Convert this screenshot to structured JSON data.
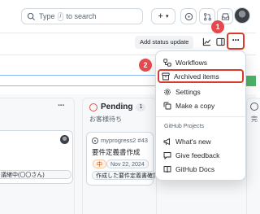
{
  "header": {
    "search_prefix": "Type",
    "search_key": "/",
    "search_suffix": "to search",
    "plus_label": "+",
    "plus_caret": "▾"
  },
  "toolbar": {
    "status_label": "Add status update",
    "more_label": "···",
    "badge1": "1",
    "badge2": "2"
  },
  "board": {
    "left_card_chip": "議継中(〇〇さん)",
    "pending": {
      "title": "Pending",
      "count": "1",
      "description": "お客様待ち",
      "card": {
        "repo": "myprogress2 #43",
        "title": "要件定義書作成",
        "priority": "中",
        "date": "Nov 22, 2024",
        "note": "作成した要件定義書確認"
      }
    },
    "right_col_fragment": "完"
  },
  "menu": {
    "items": [
      {
        "label": "Workflows",
        "icon": "workflow-icon"
      },
      {
        "label": "Archived items",
        "icon": "archive-icon"
      },
      {
        "label": "Settings",
        "icon": "gear-icon"
      },
      {
        "label": "Make a copy",
        "icon": "copy-icon"
      }
    ],
    "group_title": "GitHub Projects",
    "group_items": [
      {
        "label": "What's new",
        "icon": "megaphone-icon"
      },
      {
        "label": "Give feedback",
        "icon": "feedback-icon"
      },
      {
        "label": "GitHub Docs",
        "icon": "book-icon"
      }
    ]
  },
  "colors": {
    "annotation_red": "#d93a2b",
    "badge_red": "#e5484d",
    "pending_red": "#e5534b",
    "accent_blue": "#8fb6f5"
  }
}
